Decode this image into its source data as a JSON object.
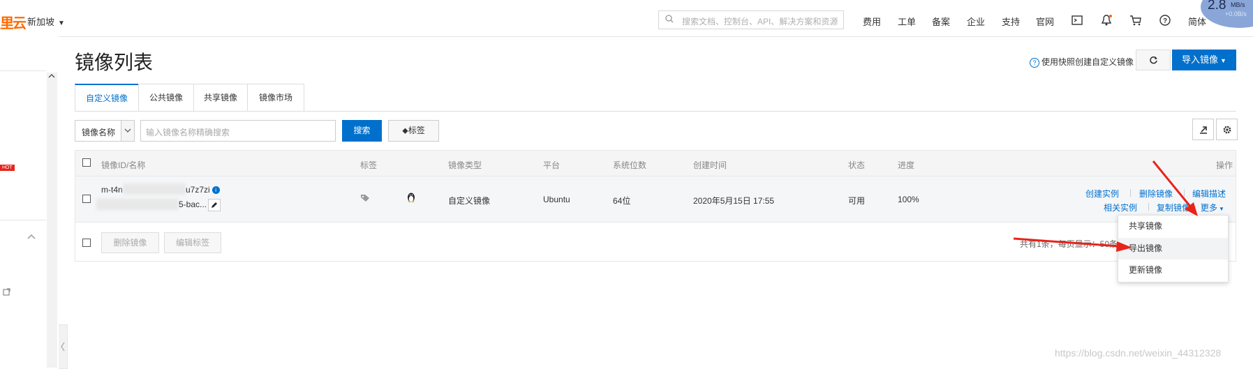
{
  "topbar": {
    "logo": "里云",
    "region": "新加坡",
    "search_placeholder": "搜索文档、控制台、API、解决方案和资源",
    "nav": [
      "费用",
      "工单",
      "备案",
      "企业",
      "支持",
      "官网"
    ],
    "language": "简体",
    "net_speed": "2.8",
    "net_speed_unit": "MB/s",
    "net_speed_up": "+0.0B/s"
  },
  "sidebar": {
    "hot_badge": "HOT"
  },
  "page": {
    "title": "镜像列表",
    "help_link": "使用快照创建自定义镜像",
    "import_button": "导入镜像"
  },
  "tabs": [
    "自定义镜像",
    "公共镜像",
    "共享镜像",
    "镜像市场"
  ],
  "filter": {
    "select_value": "镜像名称",
    "input_placeholder": "输入镜像名称精确搜索",
    "search_button": "搜索",
    "tag_button": "标签"
  },
  "table": {
    "headers": {
      "id": "镜像ID/名称",
      "tag": "标签",
      "type": "镜像类型",
      "platform": "平台",
      "bits": "系统位数",
      "created": "创建时间",
      "status": "状态",
      "progress": "进度",
      "actions": "操作"
    },
    "row": {
      "id_prefix": "m-t4n",
      "id_suffix": "u7z7zi",
      "name_suffix": "5-bac...",
      "type": "自定义镜像",
      "platform": "Ubuntu",
      "bits": "64位",
      "created": "2020年5月15日 17:55",
      "status": "可用",
      "progress": "100%",
      "actions": {
        "create_instance": "创建实例",
        "delete_image": "删除镜像",
        "edit_desc": "编辑描述",
        "related_instances": "相关实例",
        "copy_image": "复制镜像",
        "more": "更多"
      }
    },
    "footer": {
      "delete_button": "删除镜像",
      "edit_tags_button": "编辑标签",
      "summary": "共有1条，每页显示：50条"
    }
  },
  "dropdown": [
    "共享镜像",
    "导出镜像",
    "更新镜像"
  ],
  "watermark": "https://blog.csdn.net/weixin_44312328",
  "colors": {
    "primary": "#0070cc",
    "brand": "#ff6a00",
    "annotation_arrow": "#e8231a"
  }
}
